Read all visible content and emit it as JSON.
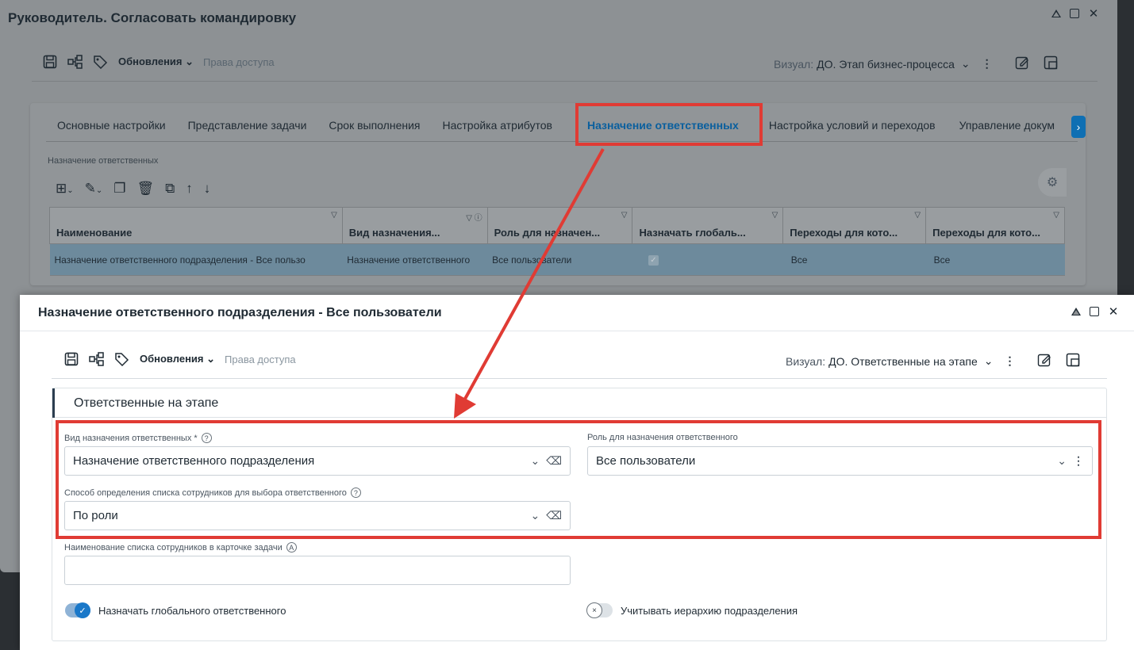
{
  "bg_window": {
    "title": "Руководитель. Согласовать командировку",
    "toolbar": {
      "updates": "Обновления",
      "access": "Права доступа"
    },
    "visual_label": "Визуал:",
    "visual_value": "ДО. Этап бизнес-процесса",
    "tabs": [
      "Основные настройки",
      "Представление задачи",
      "Срок выполнения",
      "Настройка атрибутов",
      "Назначение ответственных",
      "Настройка условий и переходов",
      "Управление докум"
    ],
    "active_tab_index": 4,
    "grid_title": "Назначение ответственных",
    "grid": {
      "headers": [
        "Наименование",
        "Вид назначения...",
        "Роль для назначен...",
        "Назначать глобаль...",
        "Переходы для кото...",
        "Переходы для кото..."
      ],
      "rows": [
        [
          "Назначение ответственного подразделения - Все пользо",
          "Назначение ответственного",
          "Все пользователи",
          "",
          "Все",
          "Все"
        ]
      ]
    }
  },
  "fg_window": {
    "title": "Назначение ответственного подразделения - Все пользователи",
    "toolbar": {
      "updates": "Обновления",
      "access": "Права доступа"
    },
    "visual_label": "Визуал:",
    "visual_value": "ДО. Ответственные на этапе",
    "section_title": "Ответственные на этапе",
    "fields": {
      "assign_type_label": "Вид назначения ответственных *",
      "assign_type_value": "Назначение ответственного подразделения",
      "role_label": "Роль для назначения ответственного",
      "role_value": "Все пользователи",
      "method_label": "Способ определения списка сотрудников для выбора ответственного",
      "method_value": "По роли",
      "list_name_label": "Наименование списка сотрудников в карточке задачи",
      "list_name_value": ""
    },
    "toggles": {
      "global_label": "Назначать глобального ответственного",
      "global_on": true,
      "hierarchy_label": "Учитывать иерархию подразделения",
      "hierarchy_on": false
    }
  },
  "colors": {
    "highlight": "#e03b34",
    "accent": "#1a78c9"
  }
}
